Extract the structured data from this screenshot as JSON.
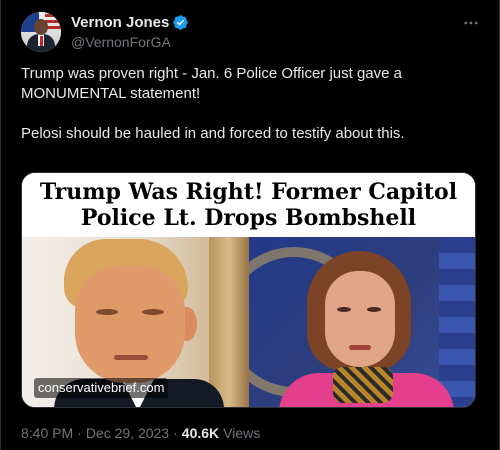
{
  "tweet": {
    "author": {
      "name": "Vernon Jones",
      "handle": "@VernonForGA",
      "verified": true,
      "verified_color": "#1d9bf0"
    },
    "more_icon": "ellipsis-icon",
    "text": "Trump was proven right - Jan. 6 Police Officer just gave a MONUMENTAL statement!\n\nPelosi should be hauled in and forced to testify about this.",
    "media": {
      "headline": "Trump Was Right! Former Capitol Police Lt. Drops Bombshell",
      "watermark": "conservativebrief.com"
    },
    "time": "8:40 PM",
    "separator": "·",
    "date": "Dec 29, 2023",
    "views_count": "40.6K",
    "views_label": "Views"
  },
  "colors": {
    "background": "#000000",
    "text": "#e7e9ea",
    "secondary": "#71767b",
    "border": "#2f3336"
  }
}
